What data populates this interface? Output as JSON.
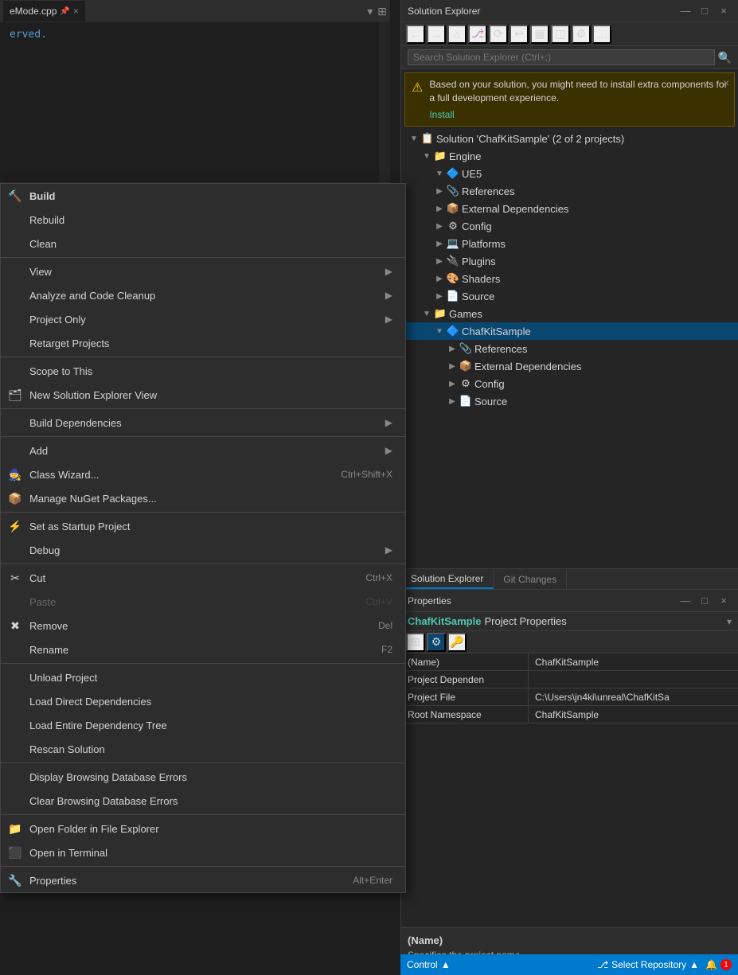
{
  "editor": {
    "tab_label": "eMode.cpp",
    "content": "erved.",
    "pin_icon": "📌",
    "close_icon": "×"
  },
  "context_menu": {
    "items": [
      {
        "id": "build",
        "label": "Build",
        "icon": "🔨",
        "shortcut": "",
        "arrow": false,
        "separator_after": false,
        "bold": true,
        "dim": false
      },
      {
        "id": "rebuild",
        "label": "Rebuild",
        "icon": "",
        "shortcut": "",
        "arrow": false,
        "separator_after": false,
        "bold": false,
        "dim": false
      },
      {
        "id": "clean",
        "label": "Clean",
        "icon": "",
        "shortcut": "",
        "arrow": false,
        "separator_after": true,
        "bold": false,
        "dim": false
      },
      {
        "id": "view",
        "label": "View",
        "icon": "",
        "shortcut": "",
        "arrow": true,
        "separator_after": false,
        "bold": false,
        "dim": false
      },
      {
        "id": "analyze",
        "label": "Analyze and Code Cleanup",
        "icon": "",
        "shortcut": "",
        "arrow": true,
        "separator_after": false,
        "bold": false,
        "dim": false
      },
      {
        "id": "project-only",
        "label": "Project Only",
        "icon": "",
        "shortcut": "",
        "arrow": true,
        "separator_after": false,
        "bold": false,
        "dim": false
      },
      {
        "id": "retarget",
        "label": "Retarget Projects",
        "icon": "",
        "shortcut": "",
        "arrow": false,
        "separator_after": true,
        "bold": false,
        "dim": false
      },
      {
        "id": "scope",
        "label": "Scope to This",
        "icon": "",
        "shortcut": "",
        "arrow": false,
        "separator_after": false,
        "bold": false,
        "dim": false
      },
      {
        "id": "new-se-view",
        "label": "New Solution Explorer View",
        "icon": "🗂",
        "shortcut": "",
        "arrow": false,
        "separator_after": true,
        "bold": false,
        "dim": false
      },
      {
        "id": "build-dep",
        "label": "Build Dependencies",
        "icon": "",
        "shortcut": "",
        "arrow": true,
        "separator_after": true,
        "bold": false,
        "dim": false
      },
      {
        "id": "add",
        "label": "Add",
        "icon": "",
        "shortcut": "",
        "arrow": true,
        "separator_after": false,
        "bold": false,
        "dim": false
      },
      {
        "id": "class-wizard",
        "label": "Class Wizard...",
        "icon": "🧙",
        "shortcut": "Ctrl+Shift+X",
        "arrow": false,
        "separator_after": false,
        "bold": false,
        "dim": false
      },
      {
        "id": "manage-nuget",
        "label": "Manage NuGet Packages...",
        "icon": "📦",
        "shortcut": "",
        "arrow": false,
        "separator_after": true,
        "bold": false,
        "dim": false
      },
      {
        "id": "set-startup",
        "label": "Set as Startup Project",
        "icon": "⚡",
        "shortcut": "",
        "arrow": false,
        "separator_after": false,
        "bold": false,
        "dim": false
      },
      {
        "id": "debug",
        "label": "Debug",
        "icon": "",
        "shortcut": "",
        "arrow": true,
        "separator_after": true,
        "bold": false,
        "dim": false
      },
      {
        "id": "cut",
        "label": "Cut",
        "icon": "✂",
        "shortcut": "Ctrl+X",
        "arrow": false,
        "separator_after": false,
        "bold": false,
        "dim": false
      },
      {
        "id": "paste",
        "label": "Paste",
        "icon": "",
        "shortcut": "Ctrl+V",
        "arrow": false,
        "separator_after": false,
        "bold": false,
        "dim": true
      },
      {
        "id": "remove",
        "label": "Remove",
        "icon": "✖",
        "shortcut": "Del",
        "arrow": false,
        "separator_after": false,
        "bold": false,
        "dim": false
      },
      {
        "id": "rename",
        "label": "Rename",
        "icon": "",
        "shortcut": "F2",
        "arrow": false,
        "separator_after": true,
        "bold": false,
        "dim": false
      },
      {
        "id": "unload",
        "label": "Unload Project",
        "icon": "",
        "shortcut": "",
        "arrow": false,
        "separator_after": false,
        "bold": false,
        "dim": false
      },
      {
        "id": "load-direct",
        "label": "Load Direct Dependencies",
        "icon": "",
        "shortcut": "",
        "arrow": false,
        "separator_after": false,
        "bold": false,
        "dim": false
      },
      {
        "id": "load-entire",
        "label": "Load Entire Dependency Tree",
        "icon": "",
        "shortcut": "",
        "arrow": false,
        "separator_after": false,
        "bold": false,
        "dim": false
      },
      {
        "id": "rescan",
        "label": "Rescan Solution",
        "icon": "",
        "shortcut": "",
        "arrow": false,
        "separator_after": true,
        "bold": false,
        "dim": false
      },
      {
        "id": "display-errors",
        "label": "Display Browsing Database Errors",
        "icon": "",
        "shortcut": "",
        "arrow": false,
        "separator_after": false,
        "bold": false,
        "dim": false
      },
      {
        "id": "clear-errors",
        "label": "Clear Browsing Database Errors",
        "icon": "",
        "shortcut": "",
        "arrow": false,
        "separator_after": true,
        "bold": false,
        "dim": false
      },
      {
        "id": "open-folder",
        "label": "Open Folder in File Explorer",
        "icon": "📁",
        "shortcut": "",
        "arrow": false,
        "separator_after": false,
        "bold": false,
        "dim": false
      },
      {
        "id": "open-terminal",
        "label": "Open in Terminal",
        "icon": "⬛",
        "shortcut": "",
        "arrow": false,
        "separator_after": true,
        "bold": false,
        "dim": false
      },
      {
        "id": "properties",
        "label": "Properties",
        "icon": "🔧",
        "shortcut": "Alt+Enter",
        "arrow": false,
        "separator_after": false,
        "bold": false,
        "dim": false
      }
    ]
  },
  "solution_explorer": {
    "title": "Solution Explorer",
    "search_placeholder": "Search Solution Explorer (Ctrl+;)",
    "warning": {
      "text": "Based on your solution, you might need to install extra components for a full development experience.",
      "install_label": "Install"
    },
    "tree": {
      "solution_label": "Solution 'ChafKitSample' (2 of 2 projects)",
      "engine_label": "Engine",
      "ue5_label": "UE5",
      "engine_items": [
        {
          "label": "References",
          "indent": 3,
          "expanded": false
        },
        {
          "label": "External Dependencies",
          "indent": 3,
          "expanded": false
        },
        {
          "label": "Config",
          "indent": 3,
          "expanded": false
        },
        {
          "label": "Platforms",
          "indent": 3,
          "expanded": false
        },
        {
          "label": "Plugins",
          "indent": 3,
          "expanded": false
        },
        {
          "label": "Shaders",
          "indent": 3,
          "expanded": false
        },
        {
          "label": "Source",
          "indent": 3,
          "expanded": false
        }
      ],
      "games_label": "Games",
      "chafkit_label": "ChafKitSample",
      "chafkit_items": [
        {
          "label": "References",
          "indent": 4,
          "expanded": false
        },
        {
          "label": "External Dependencies",
          "indent": 4,
          "expanded": false
        },
        {
          "label": "Config",
          "indent": 4,
          "expanded": false
        },
        {
          "label": "Source",
          "indent": 4,
          "expanded": false
        }
      ]
    },
    "tabs": [
      {
        "id": "se",
        "label": "Solution Explorer",
        "active": true
      },
      {
        "id": "git",
        "label": "Git Changes",
        "active": false
      }
    ]
  },
  "properties": {
    "title": "Properties",
    "project_name": "ChafKitSample",
    "project_properties_label": "Project Properties",
    "rows": [
      {
        "name": "(Name)",
        "value": "ChafKitSample"
      },
      {
        "name": "Project Dependen",
        "value": ""
      },
      {
        "name": "Project File",
        "value": "C:\\Users\\jn4ki\\unreal\\ChafKitSa"
      },
      {
        "name": "Root Namespace",
        "value": "ChafKitSample"
      }
    ],
    "desc_name": "(Name)",
    "desc_text": "Specifies the project name."
  },
  "status_bar": {
    "control_label": "Control",
    "select_repo_label": "Select Repository",
    "bell_icon": "🔔"
  },
  "icons": {
    "expand_collapsed": "▶",
    "expand_open": "▼",
    "pin": "📌",
    "close": "×",
    "back": "←",
    "forward": "→",
    "home": "⌂",
    "sync": "⟳",
    "undo": "↩",
    "layout": "▦",
    "preview": "◫",
    "settings": "⚙",
    "more": "…",
    "search": "🔍",
    "warning": "⚠",
    "folder": "📁",
    "solution": "📋",
    "project": "🔷",
    "references": "📎",
    "extdeps": "📦",
    "config": "⚙",
    "platforms": "💻",
    "plugins": "🔌",
    "shaders": "🎨",
    "source": "📄",
    "arrow_right": "▶"
  }
}
